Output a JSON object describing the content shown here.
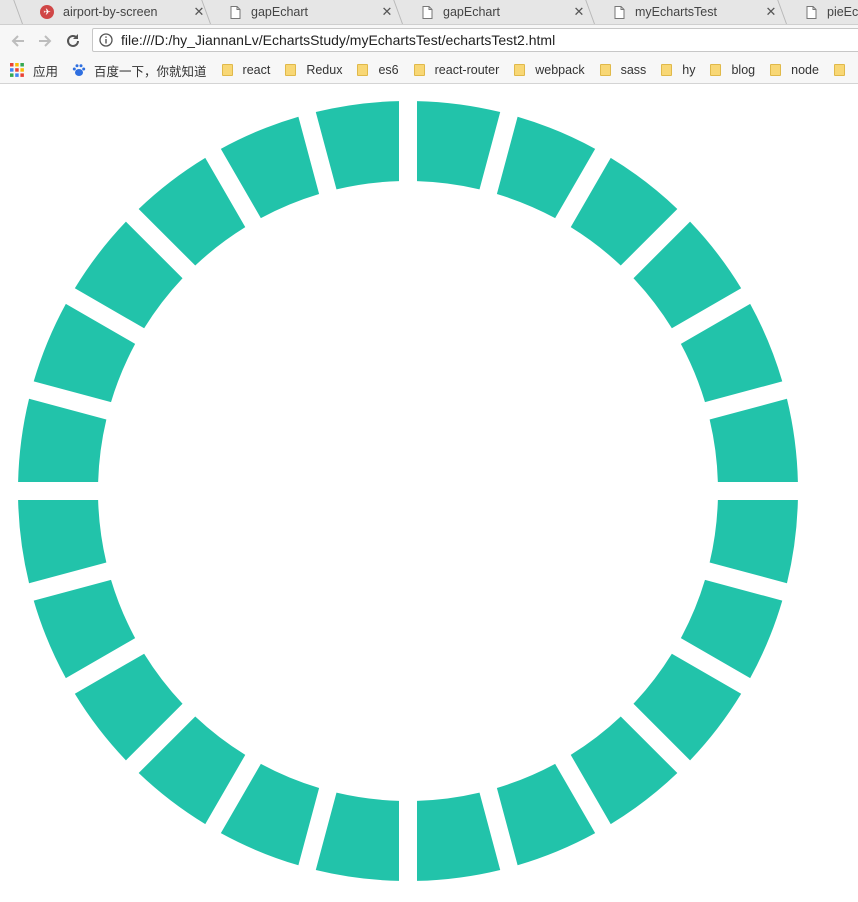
{
  "tabs": [
    {
      "label": "airport-by-screen",
      "icon": "app-favicon-icon"
    },
    {
      "label": "gapEchart",
      "icon": "document-icon"
    },
    {
      "label": "gapEchart",
      "icon": "document-icon"
    },
    {
      "label": "myEchartsTest",
      "icon": "document-icon"
    },
    {
      "label": "pieEcha",
      "icon": "document-icon"
    }
  ],
  "tab_close_glyph": "✕",
  "address_bar": {
    "url": "file:///D:/hy_JiannanLv/EchartsStudy/myEchartsTest/echartsTest2.html"
  },
  "bookmarks": [
    {
      "label": "应用",
      "icon": "apps-grid-icon"
    },
    {
      "label": "百度一下，你就知道",
      "icon": "baidu-paw-icon"
    },
    {
      "label": "react",
      "icon": "folder-icon"
    },
    {
      "label": "Redux",
      "icon": "folder-icon"
    },
    {
      "label": "es6",
      "icon": "folder-icon"
    },
    {
      "label": "react-router",
      "icon": "folder-icon"
    },
    {
      "label": "webpack",
      "icon": "folder-icon"
    },
    {
      "label": "sass",
      "icon": "folder-icon"
    },
    {
      "label": "hy",
      "icon": "folder-icon"
    },
    {
      "label": "blog",
      "icon": "folder-icon"
    },
    {
      "label": "node",
      "icon": "folder-icon"
    }
  ],
  "chart_data": {
    "type": "pie",
    "variant": "donut",
    "segments": 24,
    "values": [
      1,
      1,
      1,
      1,
      1,
      1,
      1,
      1,
      1,
      1,
      1,
      1,
      1,
      1,
      1,
      1,
      1,
      1,
      1,
      1,
      1,
      1,
      1,
      1
    ],
    "color": "#22c3aa",
    "title": ""
  }
}
